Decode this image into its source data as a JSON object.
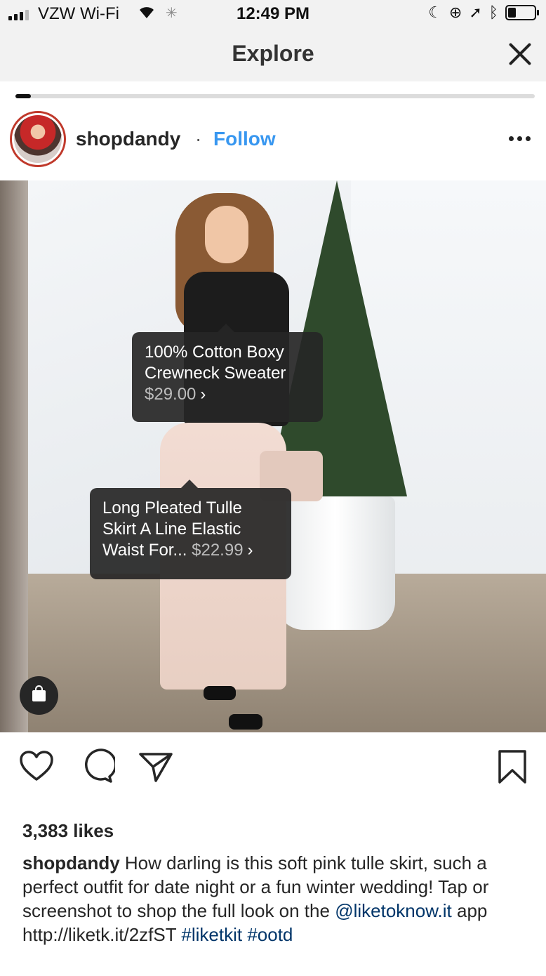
{
  "status_bar": {
    "carrier": "VZW Wi-Fi",
    "time": "12:49 PM",
    "battery_level": 0.3
  },
  "header": {
    "title": "Explore"
  },
  "story": {
    "progress": 0.03
  },
  "post": {
    "username": "shopdandy",
    "separator": "·",
    "follow_label": "Follow",
    "tags": [
      {
        "name_line1": "100% Cotton Boxy",
        "name_line2": "Crewneck Sweater",
        "price": "$29.00"
      },
      {
        "name_line1": "Long Pleated Tulle",
        "name_line2": "Skirt A Line Elastic",
        "name_line3": "Waist For...",
        "price": "$22.99"
      }
    ],
    "likes": "3,383 likes",
    "caption": {
      "user": "shopdandy",
      "text1": " How darling is this soft pink tulle skirt, such a perfect outfit for date night or a fun winter wedding! Tap or screenshot to shop the full look on the ",
      "mention": "@liketoknow.it",
      "text2": " app http://liketk.it/2zfST ",
      "hashtag1": "#liketkit",
      "space": " ",
      "hashtag2": "#ootd"
    }
  },
  "icons": {
    "signal": "signal-bars-icon",
    "wifi": "wifi-icon",
    "loading": "activity-spinner-icon",
    "moon": "moon-icon",
    "rotation_lock": "rotation-lock-icon",
    "location": "location-arrow-icon",
    "bluetooth": "bluetooth-icon",
    "battery": "battery-icon",
    "close": "close-icon",
    "more": "more-dots-icon",
    "shopping_bag": "shopping-bag-icon",
    "like": "heart-icon",
    "comment": "comment-icon",
    "share": "paper-plane-icon",
    "save": "bookmark-icon"
  }
}
